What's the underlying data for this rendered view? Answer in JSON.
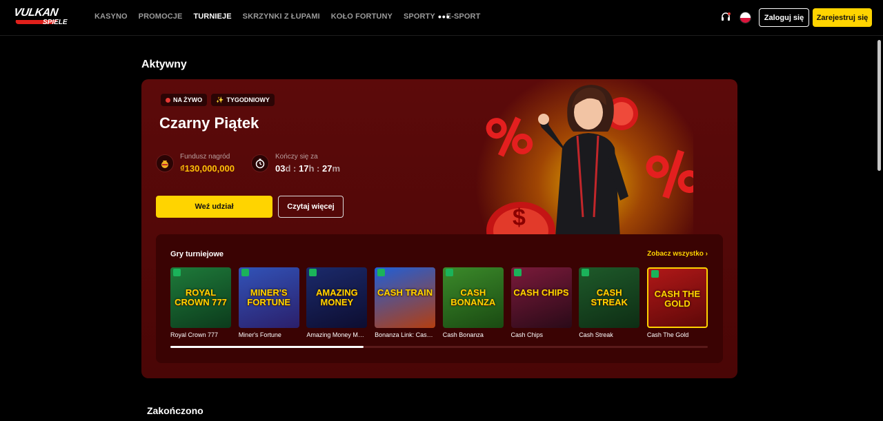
{
  "brand": {
    "logo_main": "VULKAN",
    "logo_sub": "SPIELE"
  },
  "nav": {
    "items": [
      "KASYNO",
      "PROMOCJE",
      "TURNIEJE",
      "SKRZYNKI Z ŁUPAMI",
      "KOŁO FORTUNY",
      "SPORTY",
      "E-SPORT"
    ],
    "active": "TURNIEJE",
    "more": "•••"
  },
  "header": {
    "login": "Zaloguj się",
    "register": "Zarejestruj się",
    "language": "pl"
  },
  "sections": {
    "active": "Aktywny",
    "ended": "Zakończono"
  },
  "tournament": {
    "badges": [
      "NA ŻYWO",
      "TYGODNIOWY"
    ],
    "title": "Czarny Piątek",
    "prize_label": "Fundusz nagród",
    "prize_value": "₫130,000,000",
    "ends_label": "Kończy się za",
    "timer": {
      "d": "03",
      "h": "17",
      "m": "27"
    },
    "join": "Weź udział",
    "read_more": "Czytaj więcej"
  },
  "games": {
    "title": "Gry turniejowe",
    "see_all": "Zobacz wszystko",
    "scroll_progress": 0.36,
    "items": [
      {
        "name": "Royal Crown 777",
        "art": "ROYAL CROWN 777",
        "colors": [
          "#1e7a3a",
          "#0c3b1c"
        ]
      },
      {
        "name": "Miner's Fortune",
        "art": "MINER'S FORTUNE",
        "colors": [
          "#3153b8",
          "#2b1f6a"
        ]
      },
      {
        "name": "Amazing Money Mac...",
        "art": "AMAZING MONEY",
        "colors": [
          "#1b2a6b",
          "#0d0d30"
        ]
      },
      {
        "name": "Bonanza Link: Cash ...",
        "art": "CASH TRAIN",
        "colors": [
          "#1f5fd8",
          "#b43e10"
        ]
      },
      {
        "name": "Cash Bonanza",
        "art": "CASH BONANZA",
        "colors": [
          "#3b8a2a",
          "#1a4a12"
        ]
      },
      {
        "name": "Cash Chips",
        "art": "CASH CHIPS",
        "colors": [
          "#7a1a3a",
          "#2a0a18"
        ]
      },
      {
        "name": "Cash Streak",
        "art": "CASH STREAK",
        "colors": [
          "#1e5a2a",
          "#0e2d14"
        ]
      },
      {
        "name": "Cash The Gold",
        "art": "CASH THE GOLD",
        "colors": [
          "#b01818",
          "#5e0808"
        ]
      }
    ]
  }
}
